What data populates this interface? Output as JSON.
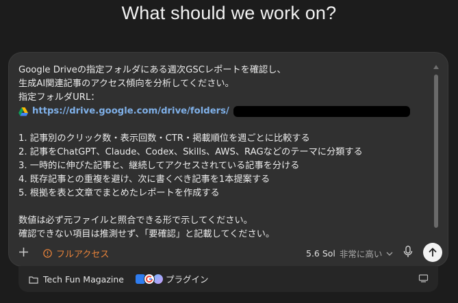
{
  "heading": "What should we work on?",
  "prompt": {
    "lines": [
      "Google Driveの指定フォルダにある週次GSCレポートを確認し、",
      "生成AI関連記事のアクセス傾向を分析してください。",
      "指定フォルダURL："
    ],
    "url": "https://drive.google.com/drive/folders/",
    "tasks": [
      "1. 記事別のクリック数・表示回数・CTR・掲載順位を週ごとに比較する",
      "2. 記事をChatGPT、Claude、Codex、Skills、AWS、RAGなどのテーマに分類する",
      "3. 一時的に伸びた記事と、継続してアクセスされている記事を分ける",
      "4. 既存記事との重複を避け、次に書くべき記事を1本提案する",
      "5. 根拠を表と文章でまとめたレポートを作成する"
    ],
    "closing": [
      "数値は必ず元ファイルと照合できる形で示してください。",
      "確認できない項目は推測せず、「要確認」と記載してください。"
    ]
  },
  "toolbar": {
    "access_label": "フルアクセス",
    "model": "5.6 Sol",
    "effort": "非常に高い"
  },
  "bottom": {
    "project": "Tech Fun Magazine",
    "plugins_label": "プラグイン"
  },
  "colors": {
    "background": "#1c1c1c",
    "composer": "#303030",
    "accent_warning": "#e8833a",
    "link": "#7fb0e8"
  }
}
